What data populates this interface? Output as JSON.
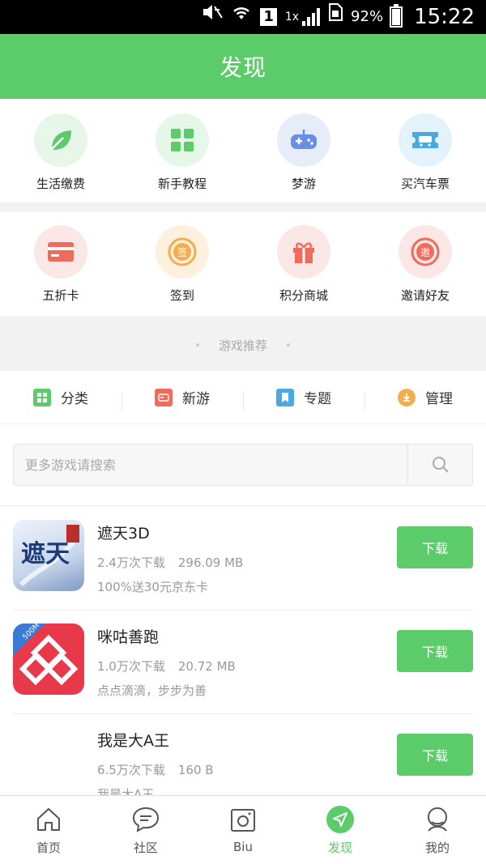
{
  "status_bar": {
    "network": "1x",
    "sim": "1",
    "battery": "92%",
    "time": "15:22"
  },
  "header": {
    "title": "发现"
  },
  "services_row1": [
    {
      "label": "生活缴费",
      "icon": "leaf-icon",
      "bg": "#e6f6e9",
      "color": "#5ccb6a"
    },
    {
      "label": "新手教程",
      "icon": "grid-icon",
      "bg": "#e6f6e9",
      "color": "#5ccb6a"
    },
    {
      "label": "梦游",
      "icon": "gamepad-icon",
      "bg": "#e7ecf9",
      "color": "#6a8ee6"
    },
    {
      "label": "买汽车票",
      "icon": "bus-ticket-icon",
      "bg": "#e3f2fb",
      "color": "#4aa9e0"
    }
  ],
  "services_row2": [
    {
      "label": "五折卡",
      "icon": "card-icon",
      "bg": "#fbe7e5",
      "color": "#ef6b5c"
    },
    {
      "label": "签到",
      "icon": "checkin-icon",
      "bg": "#fdf0df",
      "color": "#f3ad4c"
    },
    {
      "label": "积分商城",
      "icon": "gift-icon",
      "bg": "#fbe7e5",
      "color": "#ef6b5c"
    },
    {
      "label": "邀请好友",
      "icon": "invite-icon",
      "bg": "#fbe7e5",
      "color": "#ef6b5c"
    }
  ],
  "section": {
    "title": "游戏推荐"
  },
  "tabs": [
    {
      "label": "分类",
      "color": "#5ccb6a"
    },
    {
      "label": "新游",
      "color": "#ef6b5c"
    },
    {
      "label": "专题",
      "color": "#4aa9e0"
    },
    {
      "label": "管理",
      "color": "#f3ad4c"
    }
  ],
  "search": {
    "placeholder": "更多游戏请搜索"
  },
  "games": [
    {
      "name": "遮天3D",
      "downloads": "2.4万次下载",
      "size": "296.09 MB",
      "desc": "100%送30元京东卡",
      "button": "下载"
    },
    {
      "name": "咪咕善跑",
      "downloads": "1.0万次下载",
      "size": "20.72 MB",
      "desc": "点点滴滴，步步为善",
      "button": "下载"
    },
    {
      "name": "我是大A王",
      "downloads": "6.5万次下载",
      "size": "160 B",
      "desc": "我是大A王",
      "button": "下载"
    }
  ],
  "game_icon_text": {
    "zhetian": "遮天",
    "migu_badge": "500M"
  },
  "bottom_nav": [
    {
      "label": "首页",
      "icon": "home-icon",
      "active": false
    },
    {
      "label": "社区",
      "icon": "chat-bubble-icon",
      "active": false
    },
    {
      "label": "Biu",
      "icon": "camera-icon",
      "active": false
    },
    {
      "label": "发现",
      "icon": "compass-icon",
      "active": true
    },
    {
      "label": "我的",
      "icon": "profile-icon",
      "active": false
    }
  ],
  "colors": {
    "brand": "#5ccb6a"
  }
}
